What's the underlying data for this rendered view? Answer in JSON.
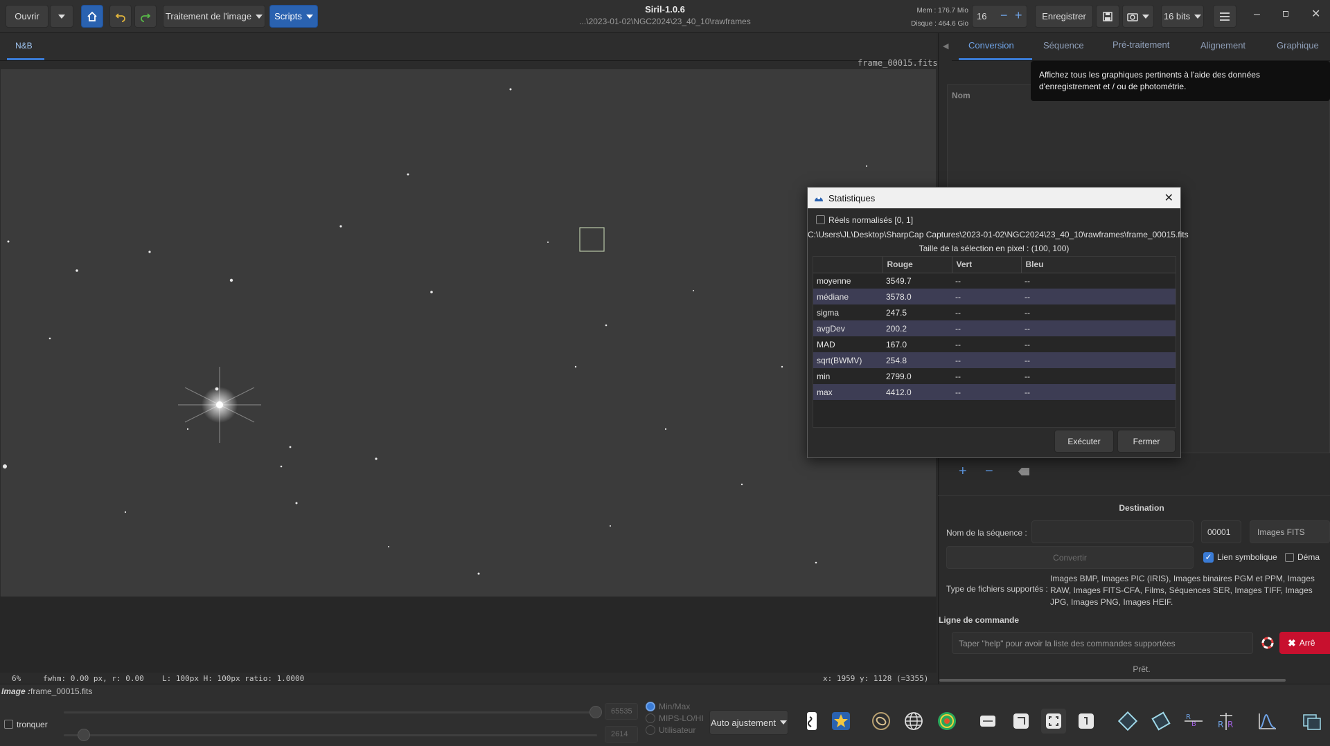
{
  "header": {
    "open_label": "Ouvrir",
    "image_processing_label": "Traitement de l'image",
    "scripts_label": "Scripts",
    "app_title": "Siril-1.0.6",
    "path": "...\\2023-01-02\\NGC2024\\23_40_10\\rawframes",
    "mem_label": "Mem : 176.7 Mio",
    "disk_label": "Disque : 464.6 Gio",
    "cpu_count": "16",
    "save_label": "Enregistrer",
    "bits_label": "16 bits"
  },
  "viewer": {
    "tab_label": "N&B",
    "filename_overlay": "frame_00015.fits"
  },
  "statusbar": {
    "zoom": "6%",
    "psf_info": "fwhm: 0.00 px, r: 0.00",
    "selection_info": "L: 100px H: 100px ratio: 1.0000",
    "coords": "x: 1959  y: 1128 (=3355)"
  },
  "bottom": {
    "image_label": "Image :",
    "image_name": "frame_00015.fits",
    "truncate_label": "tronquer",
    "high_value": "65535",
    "low_value": "2614",
    "radio_minmax": "Min/Max",
    "radio_mips": "MIPS-LO/HI",
    "radio_user": "Utilisateur",
    "auto_adjust": "Auto ajustement"
  },
  "right_panel": {
    "tabs": [
      "Conversion",
      "Séquence",
      "Pré-traitement",
      "Alignement",
      "Graphique"
    ],
    "active_tab": 0,
    "tooltip": "Affichez tous les graphiques pertinents à l'aide des données d'enregistrement et / ou de photométrie.",
    "file_list_header_name": "Nom",
    "destination_title": "Destination",
    "sequence_name_label": "Nom de la séquence :",
    "sequence_index": "00001",
    "output_type": "Images FITS",
    "convert_label": "Convertir",
    "symlink_label": "Lien symbolique",
    "debayer_label": "Déma",
    "supported_types_label": "Type de fichiers supportés :",
    "supported_types": "Images BMP, Images PIC (IRIS), Images binaires PGM et PPM, Images RAW, Images FITS-CFA, Films, Séquences SER, Images TIFF, Images JPG, Images PNG, Images HEIF.",
    "cmdline_title": "Ligne de commande",
    "cmdline_placeholder": "Taper \"help\" pour avoir la liste des commandes supportées",
    "stop_label": "Arrê",
    "status": "Prêt."
  },
  "dialog": {
    "title": "Statistiques",
    "normalized_label": "Réels normalisés [0, 1]",
    "file_path": "C:\\Users\\JL\\Desktop\\SharpCap Captures\\2023-01-02\\NGC2024\\23_40_10\\rawframes\\frame_00015.fits",
    "selection_size": "Taille de la sélection en pixel : (100, 100)",
    "columns": [
      "",
      "Rouge",
      "Vert",
      "Bleu"
    ],
    "rows": [
      {
        "label": "moyenne",
        "red": "3549.7",
        "green": "--",
        "blue": "--"
      },
      {
        "label": "médiane",
        "red": "3578.0",
        "green": "--",
        "blue": "--"
      },
      {
        "label": "sigma",
        "red": "247.5",
        "green": "--",
        "blue": "--"
      },
      {
        "label": "avgDev",
        "red": "200.2",
        "green": "--",
        "blue": "--"
      },
      {
        "label": "MAD",
        "red": "167.0",
        "green": "--",
        "blue": "--"
      },
      {
        "label": "sqrt(BWMV)",
        "red": "254.8",
        "green": "--",
        "blue": "--"
      },
      {
        "label": "min",
        "red": "2799.0",
        "green": "--",
        "blue": "--"
      },
      {
        "label": "max",
        "red": "4412.0",
        "green": "--",
        "blue": "--"
      }
    ],
    "execute_label": "Exécuter",
    "close_label": "Fermer"
  },
  "colors": {
    "accent": "#2a62b0",
    "tab_active": "#6fa3e6",
    "stop_red": "#c8102e"
  }
}
